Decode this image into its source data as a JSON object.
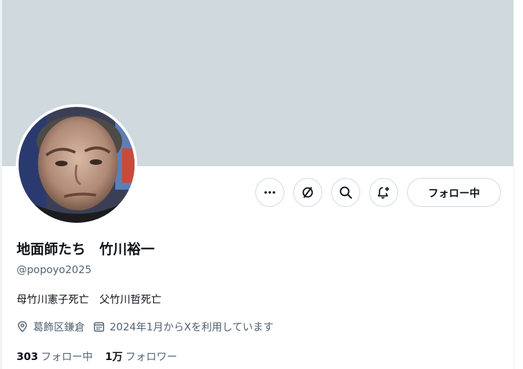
{
  "profile": {
    "display_name": "地面師たち　竹川裕一",
    "handle": "@popoyo2025",
    "bio": "母竹川憲子死亡　父竹川哲死亡",
    "location": "葛飾区鎌倉",
    "joined": "2024年1月からXを利用しています",
    "following_count": "303",
    "following_label": "フォロー中",
    "followers_count": "1万",
    "followers_label": "フォロワー"
  },
  "actions": {
    "more_icon": "more-icon",
    "grok_icon": "grok-icon",
    "search_icon": "search-icon",
    "notify_icon": "bell-plus-icon",
    "follow_button_label": "フォロー中"
  },
  "colors": {
    "banner": "#cfd9de",
    "text_primary": "#0f1419",
    "text_secondary": "#536471",
    "border": "#cfd9de"
  }
}
